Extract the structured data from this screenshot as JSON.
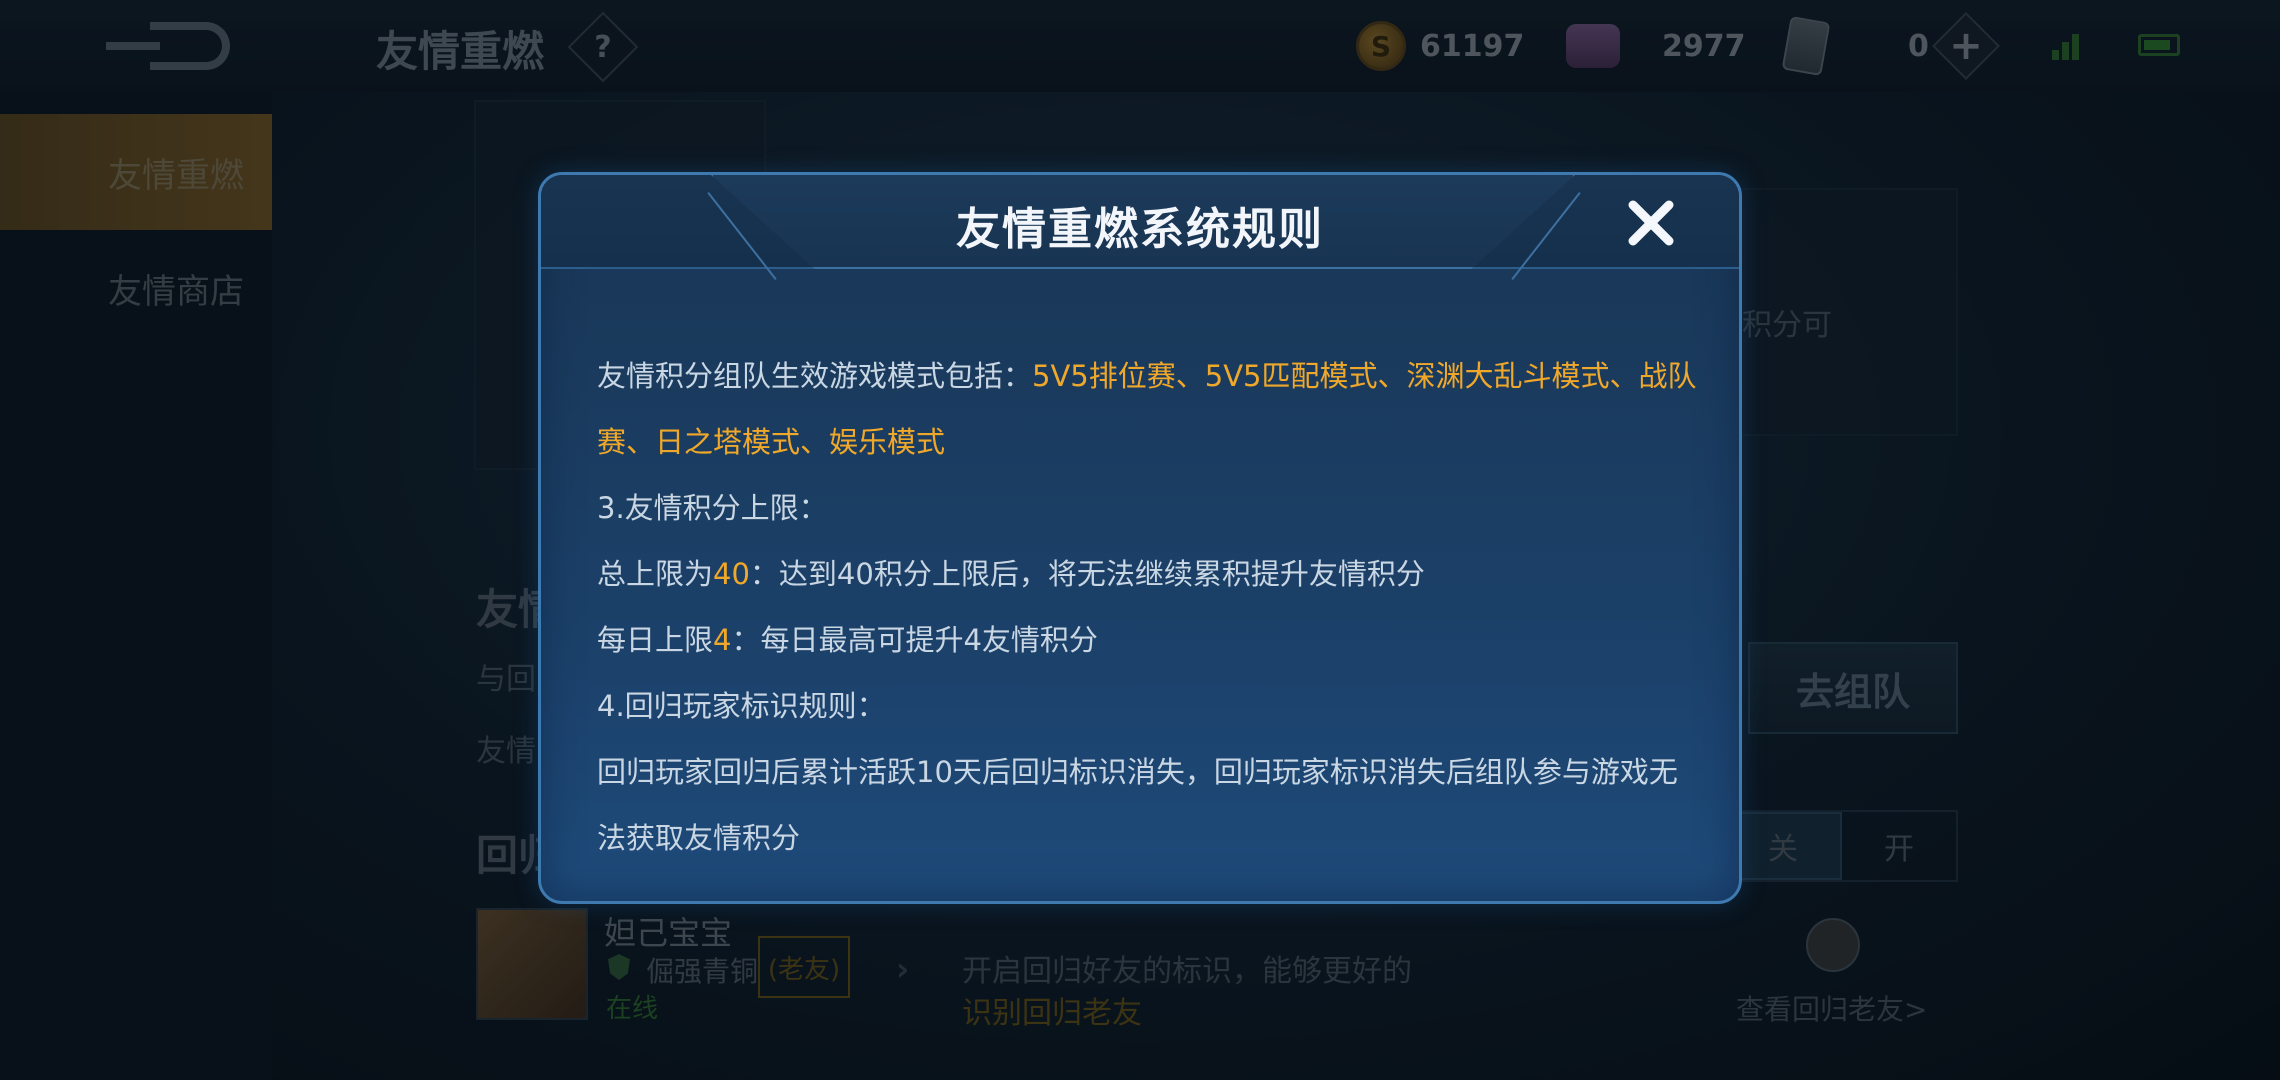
{
  "topbar": {
    "title": "友情重燃",
    "help_symbol": "?",
    "gold_coin_symbol": "S",
    "gold_amount": "61197",
    "gems_amount": "2977",
    "cards_amount": "0",
    "plus_symbol": "+"
  },
  "sidebar": {
    "items": [
      {
        "label": "友情重燃",
        "active": true
      },
      {
        "label": "友情商店",
        "active": false
      }
    ]
  },
  "background": {
    "section_heading": "友情",
    "line_1": "与回",
    "line_2": "友情",
    "right_panel_text": "积分可",
    "team_button_label": "去组队",
    "return_heading": "回归",
    "toggle_off_label": "关",
    "toggle_on_label": "开",
    "friend": {
      "name": "妲己宝宝",
      "rank": "倔强青铜",
      "tag": "(老友)",
      "status": "在线"
    },
    "row_note_line1": "开启回归好友的标识，能够更好的",
    "row_note_line2": "识别回归老友",
    "view_link": "查看回归老友>"
  },
  "modal": {
    "title": "友情重燃系统规则",
    "close_symbol": "✕",
    "lines": {
      "modes_prefix": "友情积分组队生效游戏模式包括：",
      "modes_list_a": "5V5排位赛、5V5匹配模式、深渊大乱斗模式、战队",
      "modes_list_b": "赛、日之塔模式、娱乐模式",
      "section3": "3.友情积分上限：",
      "total_prefix": "总上限为",
      "total_value": "40",
      "total_suffix": "：达到40积分上限后，将无法继续累积提升友情积分",
      "daily_prefix": "每日上限",
      "daily_value": "4",
      "daily_suffix": "：每日最高可提升4友情积分",
      "section4": "4.回归玩家标识规则：",
      "rule4_a": "回归玩家回归后累计活跃10天后回归标识消失，回归玩家标识消失后组队参与游戏无",
      "rule4_b": "法获取友情积分"
    }
  },
  "colors": {
    "highlight": "#f0a82a",
    "modal_border": "#3e79b0",
    "body_text": "#c9d6e3"
  }
}
